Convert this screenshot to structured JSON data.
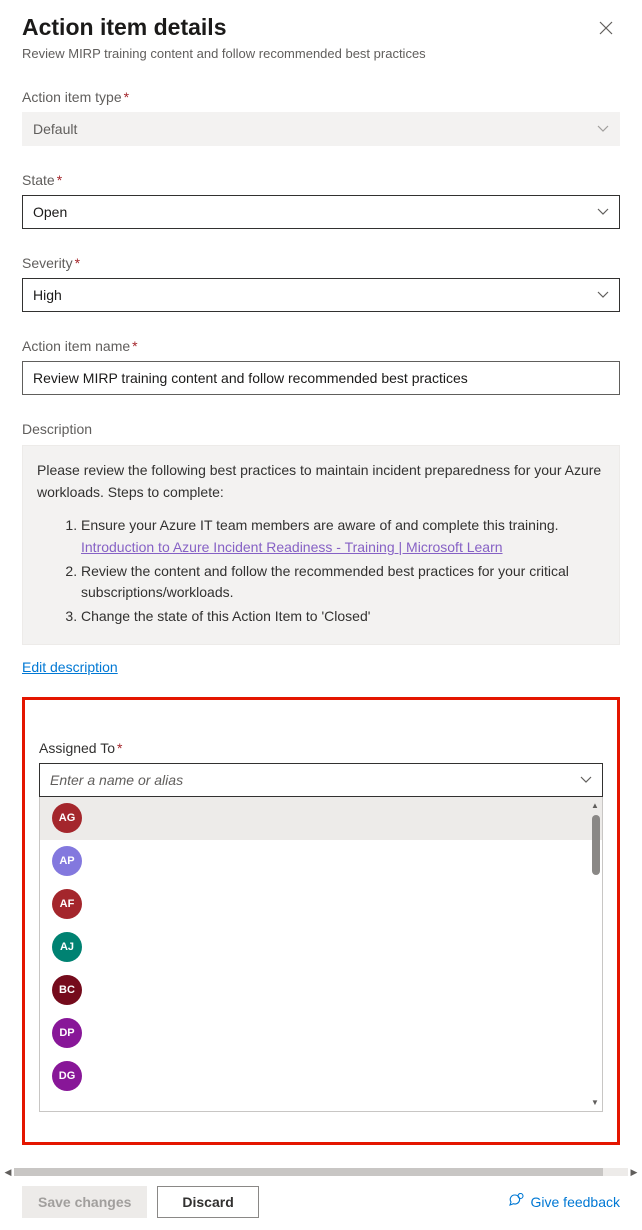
{
  "header": {
    "title": "Action item details",
    "subtitle": "Review MIRP training content and follow recommended best practices"
  },
  "fields": {
    "action_item_type": {
      "label": "Action item type",
      "value": "Default"
    },
    "state": {
      "label": "State",
      "value": "Open"
    },
    "severity": {
      "label": "Severity",
      "value": "High"
    },
    "action_item_name": {
      "label": "Action item name",
      "value": "Review MIRP training content and follow recommended best practices"
    }
  },
  "description": {
    "label": "Description",
    "intro": "Please review the following best practices to maintain incident preparedness for your Azure workloads. Steps to complete:",
    "steps": [
      {
        "pre": "Ensure your Azure IT team members are aware of and complete this training. ",
        "link": "Introduction to Azure Incident Readiness - Training | Microsoft Learn"
      },
      {
        "pre": "Review the content and follow the recommended best practices for your critical subscriptions/workloads."
      },
      {
        "pre": "Change the state of this Action Item to 'Closed'"
      }
    ],
    "edit_link": "Edit description"
  },
  "assigned_to": {
    "label": "Assigned To",
    "placeholder": "Enter a name or alias",
    "options": [
      {
        "initials": "AG",
        "color": "#a4262c",
        "selected": true
      },
      {
        "initials": "AP",
        "color": "#8378de"
      },
      {
        "initials": "AF",
        "color": "#a4262c"
      },
      {
        "initials": "AJ",
        "color": "#008272"
      },
      {
        "initials": "BC",
        "color": "#750b1c"
      },
      {
        "initials": "DP",
        "color": "#881798"
      },
      {
        "initials": "DG",
        "color": "#881798"
      }
    ]
  },
  "footer": {
    "save": "Save changes",
    "discard": "Discard",
    "feedback": "Give feedback"
  }
}
